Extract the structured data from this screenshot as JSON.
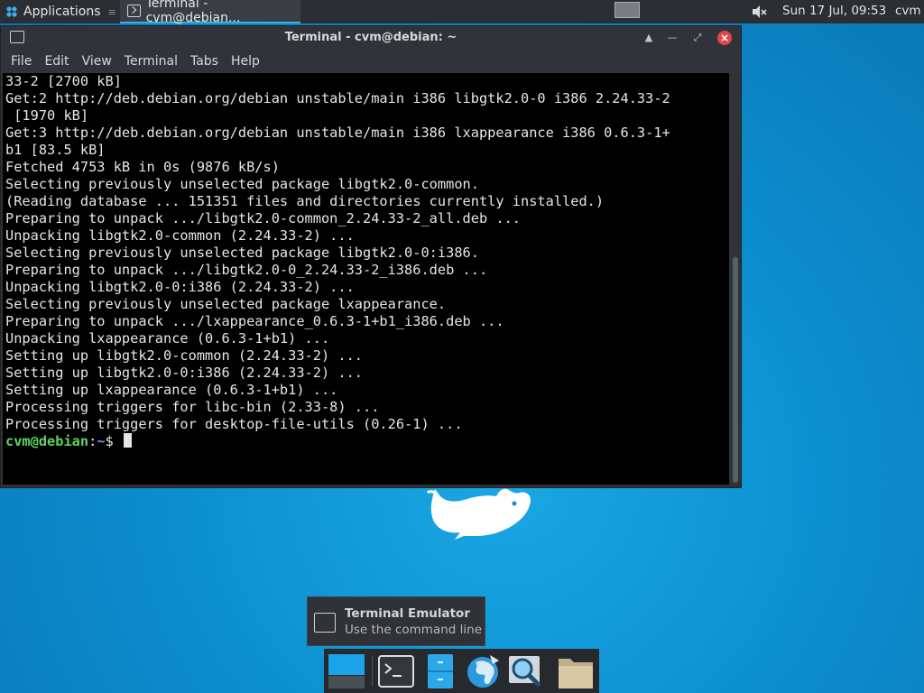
{
  "panel": {
    "applications_label": "Applications",
    "task_label": "Terminal - cvm@debian...",
    "clock": "Sun 17 Jul, 09:53",
    "user": "cvm",
    "icons": [
      "xfce-logo-icon",
      "terminal-icon",
      "workspace-switcher",
      "volume-muted-icon"
    ]
  },
  "window": {
    "title": "Terminal - cvm@debian: ~",
    "menu": [
      "File",
      "Edit",
      "View",
      "Terminal",
      "Tabs",
      "Help"
    ],
    "controls": [
      "shade-icon",
      "minimize-icon",
      "maximize-icon",
      "close-icon"
    ]
  },
  "terminal": {
    "lines": [
      "33-2 [2700 kB]",
      "Get:2 http://deb.debian.org/debian unstable/main i386 libgtk2.0-0 i386 2.24.33-2",
      " [1970 kB]",
      "Get:3 http://deb.debian.org/debian unstable/main i386 lxappearance i386 0.6.3-1+",
      "b1 [83.5 kB]",
      "Fetched 4753 kB in 0s (9876 kB/s)",
      "Selecting previously unselected package libgtk2.0-common.",
      "(Reading database ... 151351 files and directories currently installed.)",
      "Preparing to unpack .../libgtk2.0-common_2.24.33-2_all.deb ...",
      "Unpacking libgtk2.0-common (2.24.33-2) ...",
      "Selecting previously unselected package libgtk2.0-0:i386.",
      "Preparing to unpack .../libgtk2.0-0_2.24.33-2_i386.deb ...",
      "Unpacking libgtk2.0-0:i386 (2.24.33-2) ...",
      "Selecting previously unselected package lxappearance.",
      "Preparing to unpack .../lxappearance_0.6.3-1+b1_i386.deb ...",
      "Unpacking lxappearance (0.6.3-1+b1) ...",
      "Setting up libgtk2.0-common (2.24.33-2) ...",
      "Setting up libgtk2.0-0:i386 (2.24.33-2) ...",
      "Setting up lxappearance (0.6.3-1+b1) ...",
      "Processing triggers for libc-bin (2.33-8) ...",
      "Processing triggers for desktop-file-utils (0.26-1) ..."
    ],
    "prompt_user": "cvm@debian",
    "prompt_sep": ":",
    "prompt_path": "~",
    "prompt_symbol": "$ "
  },
  "tooltip": {
    "title": "Terminal Emulator",
    "subtitle": "Use the command line"
  },
  "dock": {
    "items": [
      "show-desktop-icon",
      "terminal-icon",
      "file-manager-icon",
      "web-browser-icon",
      "app-finder-icon",
      "folder-icon"
    ]
  }
}
